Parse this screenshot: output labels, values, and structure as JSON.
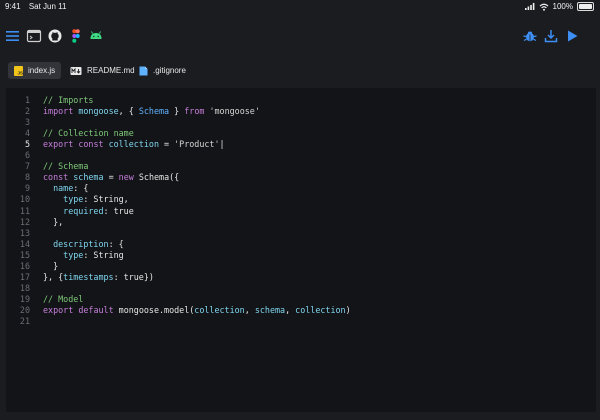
{
  "status": {
    "time": "9:41",
    "date": "Sat Jun 11",
    "battery": "100%"
  },
  "toolbar": {
    "left_icons": [
      "menu-icon",
      "terminal-icon",
      "github-icon",
      "figma-icon",
      "android-icon"
    ],
    "right_icons": [
      "bug-icon",
      "download-icon",
      "play-icon"
    ],
    "colors": {
      "accent": "#3d8ff5"
    }
  },
  "tabs": [
    {
      "label": "index.js",
      "icon": "js-file-icon",
      "active": true
    },
    {
      "label": "README.md",
      "icon": "markdown-file-icon",
      "active": false
    },
    {
      "label": ".gitignore",
      "icon": "file-icon",
      "active": false
    }
  ],
  "editor": {
    "current_line": 5,
    "lines": [
      {
        "num": "1",
        "tokens": [
          [
            "comment",
            "// Imports"
          ]
        ]
      },
      {
        "num": "2",
        "tokens": [
          [
            "keyword",
            "import"
          ],
          [
            "plain",
            " "
          ],
          [
            "var",
            "mongoose"
          ],
          [
            "plain",
            ", { "
          ],
          [
            "type",
            "Schema"
          ],
          [
            "plain",
            " } "
          ],
          [
            "keyword",
            "from"
          ],
          [
            "plain",
            " "
          ],
          [
            "string",
            "'mongoose'"
          ]
        ]
      },
      {
        "num": "3",
        "tokens": []
      },
      {
        "num": "4",
        "tokens": [
          [
            "comment",
            "// Collection name"
          ]
        ]
      },
      {
        "num": "5",
        "tokens": [
          [
            "keyword",
            "export"
          ],
          [
            "plain",
            " "
          ],
          [
            "keyword",
            "const"
          ],
          [
            "plain",
            " "
          ],
          [
            "var",
            "collection"
          ],
          [
            "plain",
            " = "
          ],
          [
            "string",
            "'Product'"
          ],
          [
            "cursor",
            "|"
          ]
        ]
      },
      {
        "num": "6",
        "tokens": []
      },
      {
        "num": "7",
        "tokens": [
          [
            "comment",
            "// Schema"
          ]
        ]
      },
      {
        "num": "8",
        "tokens": [
          [
            "keyword",
            "const"
          ],
          [
            "plain",
            " "
          ],
          [
            "var",
            "schema"
          ],
          [
            "plain",
            " = "
          ],
          [
            "keyword",
            "new"
          ],
          [
            "plain",
            " Schema({"
          ]
        ]
      },
      {
        "num": "9",
        "tokens": [
          [
            "plain",
            "  "
          ],
          [
            "var",
            "name"
          ],
          [
            "plain",
            ": {"
          ]
        ]
      },
      {
        "num": "10",
        "tokens": [
          [
            "plain",
            "    "
          ],
          [
            "var",
            "type"
          ],
          [
            "plain",
            ": String,"
          ]
        ]
      },
      {
        "num": "11",
        "tokens": [
          [
            "plain",
            "    "
          ],
          [
            "var",
            "required"
          ],
          [
            "plain",
            ": true"
          ]
        ]
      },
      {
        "num": "12",
        "tokens": [
          [
            "plain",
            "  },"
          ]
        ]
      },
      {
        "num": "13",
        "tokens": []
      },
      {
        "num": "14",
        "tokens": [
          [
            "plain",
            "  "
          ],
          [
            "var",
            "description"
          ],
          [
            "plain",
            ": {"
          ]
        ]
      },
      {
        "num": "15",
        "tokens": [
          [
            "plain",
            "    "
          ],
          [
            "var",
            "type"
          ],
          [
            "plain",
            ": String"
          ]
        ]
      },
      {
        "num": "16",
        "tokens": [
          [
            "plain",
            "  }"
          ]
        ]
      },
      {
        "num": "17",
        "tokens": [
          [
            "plain",
            "}, {"
          ],
          [
            "var",
            "timestamps"
          ],
          [
            "plain",
            ": true})"
          ]
        ]
      },
      {
        "num": "18",
        "tokens": []
      },
      {
        "num": "19",
        "tokens": [
          [
            "comment",
            "// Model"
          ]
        ]
      },
      {
        "num": "20",
        "tokens": [
          [
            "keyword",
            "export"
          ],
          [
            "plain",
            " "
          ],
          [
            "keyword",
            "default"
          ],
          [
            "plain",
            " mongoose.model("
          ],
          [
            "var",
            "collection"
          ],
          [
            "plain",
            ", "
          ],
          [
            "var",
            "schema"
          ],
          [
            "plain",
            ", "
          ],
          [
            "var",
            "collection"
          ],
          [
            "plain",
            ")"
          ]
        ]
      },
      {
        "num": "21",
        "tokens": []
      }
    ]
  }
}
